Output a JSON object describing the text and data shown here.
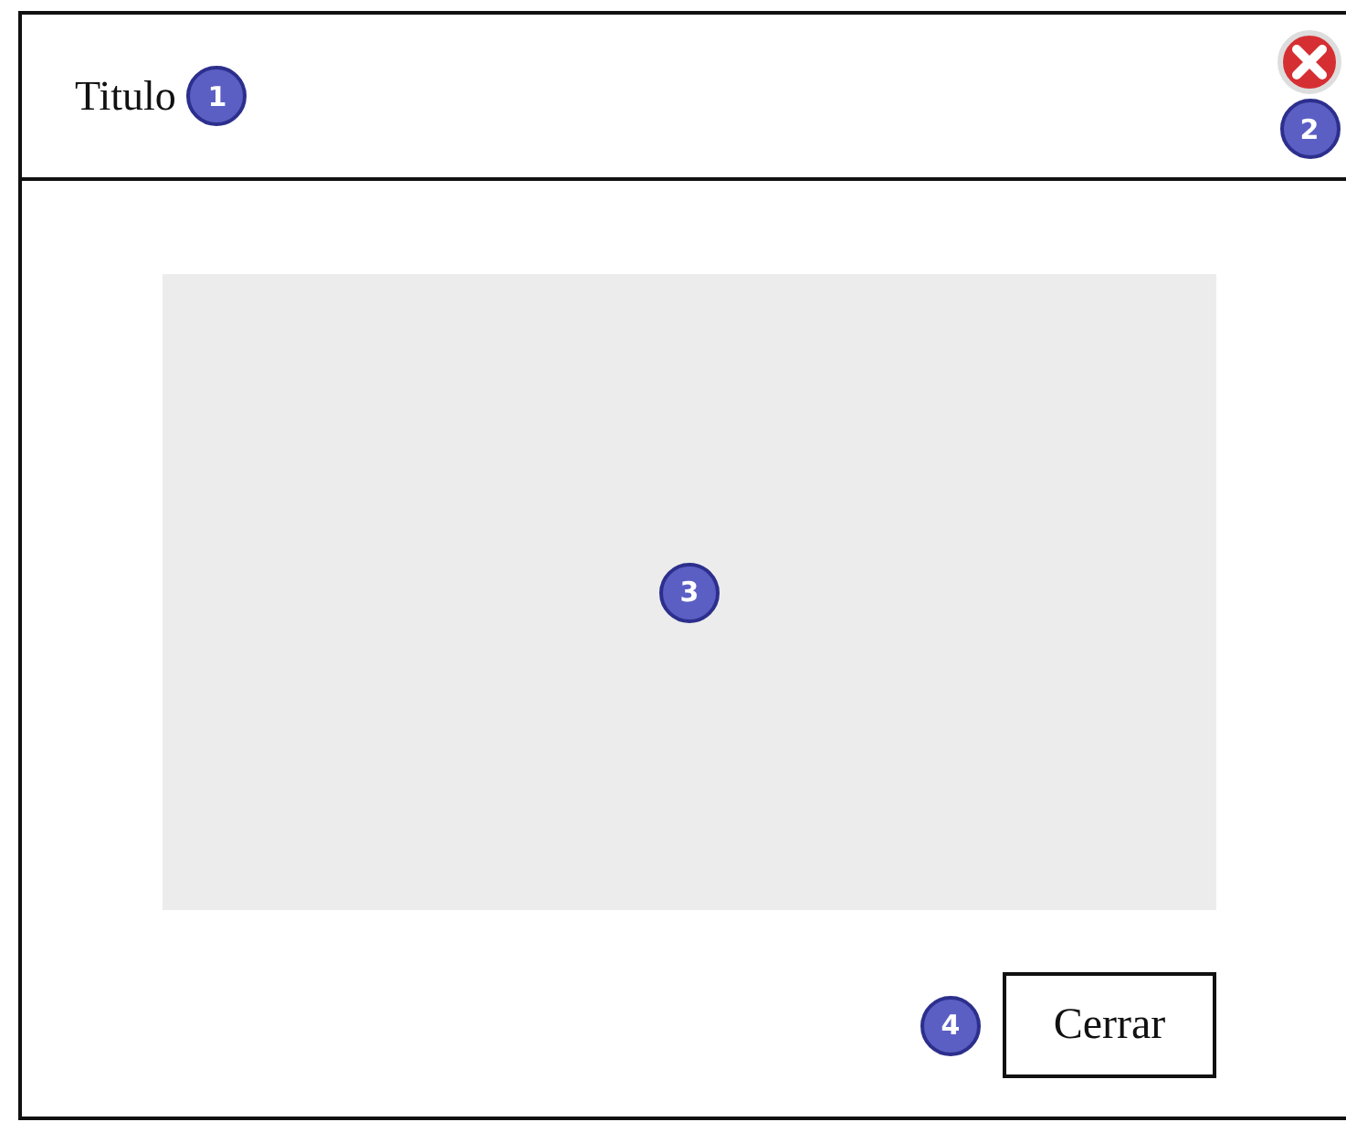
{
  "dialog": {
    "title": "Titulo",
    "title_badge": "1",
    "close_badge": "2",
    "content_badge": "3",
    "button_badge": "4",
    "buttons": [
      "Cerrar"
    ]
  }
}
